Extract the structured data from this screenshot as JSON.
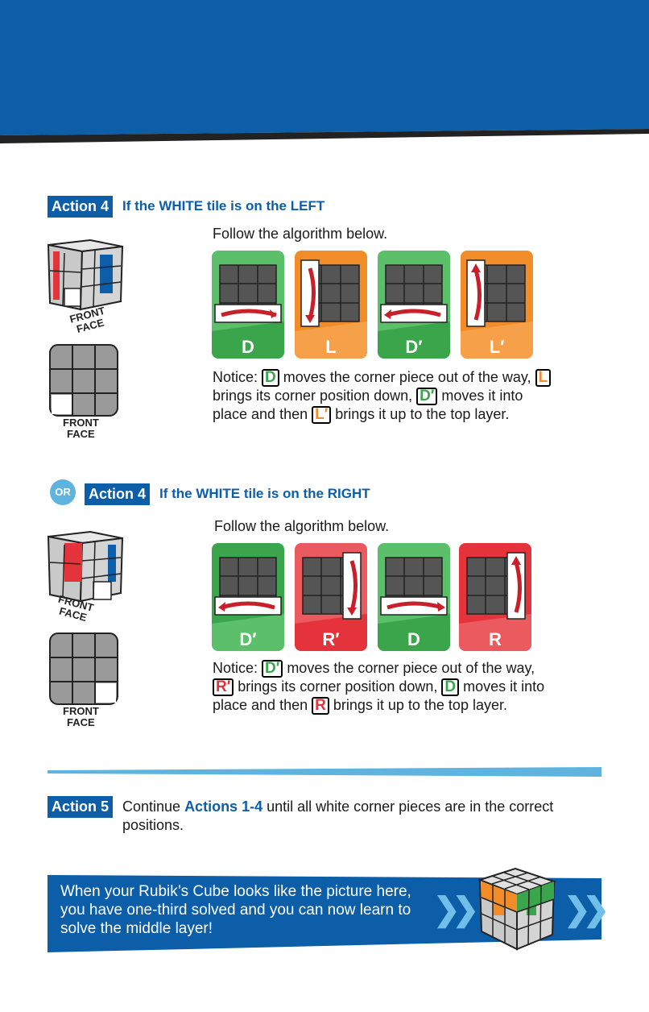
{
  "action4_left": {
    "label": "Action 4",
    "title_pre": "If the WHITE tile is on the ",
    "title_emph": "LEFT",
    "lead": "Follow the algorithm below.",
    "cube_caption_1": "FRONT",
    "cube_caption_2": "FACE",
    "flat_caption_1": "FRONT",
    "flat_caption_2": "FACE",
    "moves": [
      "D",
      "L",
      "D′",
      "L′"
    ],
    "notice": {
      "n1": "Notice: ",
      "b1": "D",
      "t1": " moves the corner piece out of the way, ",
      "b2": "L",
      "t2": " brings its corner position down, ",
      "b3": "D′",
      "t3": " moves it into place and then ",
      "b4": "L′",
      "t4": " brings it up to the top layer."
    }
  },
  "or_label": "OR",
  "action4_right": {
    "label": "Action 4",
    "title_pre": "If the WHITE tile is on the ",
    "title_emph": "RIGHT",
    "lead": "Follow the algorithm below.",
    "cube_caption_1": "FRONT",
    "cube_caption_2": "FACE",
    "flat_caption_1": "FRONT",
    "flat_caption_2": "FACE",
    "moves": [
      "D′",
      "R′",
      "D",
      "R"
    ],
    "notice": {
      "n1": "Notice: ",
      "b1": "D′",
      "t1": " moves the corner piece out of the way, ",
      "b2": "R′",
      "t2": " brings its corner position down, ",
      "b3": "D",
      "t3": " moves it into place and then ",
      "b4": "R",
      "t4": " brings it up to the top layer."
    }
  },
  "action5": {
    "label": "Action 5",
    "t1": "Continue ",
    "hl": "Actions 1-4",
    "t2": " until all white corner pieces are in the correct positions."
  },
  "banner": {
    "text": "When your Rubik’s Cube looks like the picture here, you have one-third solved and you can now learn to solve the middle layer!"
  },
  "colors": {
    "brand_blue": "#0d5ea8",
    "light_blue": "#5fb3df",
    "green": "#3aa54a",
    "orange": "#f28c28",
    "red": "#e5333c"
  }
}
